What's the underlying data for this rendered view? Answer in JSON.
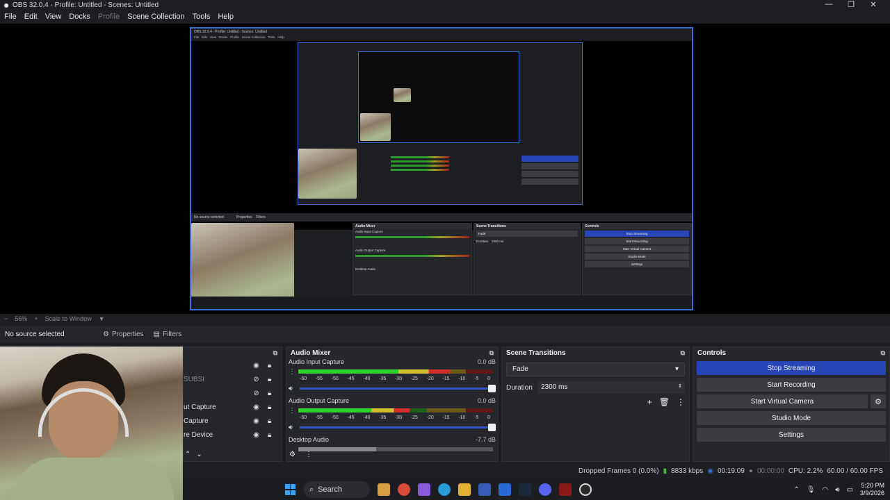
{
  "window": {
    "title": "OBS 32.0.4 - Profile: Untitled - Scenes: Untitled"
  },
  "menu": [
    "File",
    "Edit",
    "View",
    "Docks",
    "Profile",
    "Scene Collection",
    "Tools",
    "Help"
  ],
  "zoom": {
    "value": "56%",
    "minus": "−",
    "plus": "+",
    "mode": "Scale to Window"
  },
  "source_bar": {
    "no_selection": "No source selected",
    "properties": "Properties",
    "filters": "Filters"
  },
  "sources": [
    {
      "label": ""
    },
    {
      "label": "SUBSI"
    },
    {
      "label": ""
    },
    {
      "label": "ut Capture"
    },
    {
      "label": "Capture"
    },
    {
      "label": "re Device"
    }
  ],
  "mixer": {
    "title": "Audio Mixer",
    "ticks": [
      "-60",
      "-55",
      "-50",
      "-45",
      "-40",
      "-35",
      "-30",
      "-25",
      "-20",
      "-15",
      "-10",
      "-5",
      "0"
    ],
    "channels": [
      {
        "name": "Audio Input Capture",
        "db": "0.0 dB",
        "level": 0.78
      },
      {
        "name": "Audio Output Capture",
        "db": "0.0 dB",
        "level": 0.57
      },
      {
        "name": "Desktop Audio",
        "db": "-7.7 dB",
        "level": 0.4
      }
    ]
  },
  "transitions": {
    "title": "Scene Transitions",
    "selected": "Fade",
    "duration_label": "Duration",
    "duration_value": "2300 ms"
  },
  "controls": {
    "title": "Controls",
    "stop_streaming": "Stop Streaming",
    "start_recording": "Start Recording",
    "start_virtual_camera": "Start Virtual Camera",
    "studio_mode": "Studio Mode",
    "settings": "Settings"
  },
  "status": {
    "dropped": "Dropped Frames 0 (0.0%)",
    "kbps": "8833 kbps",
    "stream_time": "00:19:09",
    "rec_time": "00:00:00",
    "cpu": "CPU: 2.2%",
    "fps": "60.00 / 60.00 FPS"
  },
  "taskbar": {
    "search": "Search",
    "time": "5:20 PM",
    "date": "3/9/2026"
  },
  "colors": {
    "accent": "#2845b8",
    "preview_border": "#3a6fd8",
    "bg": "#1d1e22"
  }
}
